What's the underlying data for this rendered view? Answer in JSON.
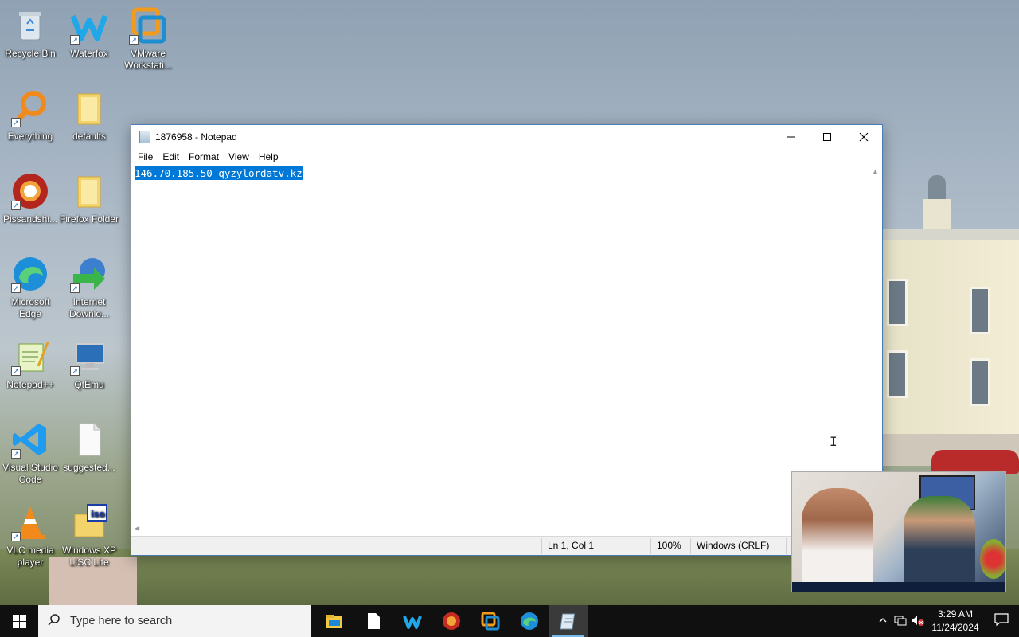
{
  "desktop": {
    "icons": [
      {
        "label": "Recycle Bin",
        "icon": "recycle-bin-icon"
      },
      {
        "label": "Waterfox",
        "icon": "waterfox-icon"
      },
      {
        "label": "VMware Workstati...",
        "icon": "vmware-icon"
      },
      {
        "label": "Everything",
        "icon": "everything-search-icon"
      },
      {
        "label": "defaults",
        "icon": "folder-icon"
      },
      {
        "label": "Pissandshi...",
        "icon": "browser-icon"
      },
      {
        "label": "Firefox Folder",
        "icon": "folder-icon"
      },
      {
        "label": "Microsoft Edge",
        "icon": "edge-icon"
      },
      {
        "label": "Internet Downlo...",
        "icon": "internet-download-manager-icon"
      },
      {
        "label": "Notepad++",
        "icon": "notepad-plus-plus-icon"
      },
      {
        "label": "QtEmu",
        "icon": "monitor-icon"
      },
      {
        "label": "Visual Studio Code",
        "icon": "vscode-icon"
      },
      {
        "label": "suggested...",
        "icon": "blank-file-icon"
      },
      {
        "label": "VLC media player",
        "icon": "vlc-cone-icon"
      },
      {
        "label": "Windows XP LISC Lite",
        "icon": "iso-folder-icon"
      }
    ]
  },
  "notepad": {
    "title": "1876958 - Notepad",
    "menu": [
      "File",
      "Edit",
      "Format",
      "View",
      "Help"
    ],
    "content": "146.70.185.50 qyzylordatv.kz",
    "status": {
      "position": "Ln 1, Col 1",
      "zoom": "100%",
      "line_ending": "Windows (CRLF)"
    }
  },
  "taskbar": {
    "search_placeholder": "Type here to search",
    "apps": [
      "file-explorer",
      "file",
      "waterfox",
      "browser",
      "vmware",
      "edge",
      "notepad"
    ],
    "clock_time": "3:29 AM",
    "clock_date": "11/24/2024"
  },
  "colors": {
    "selection": "#0078d7",
    "taskbar": "#101010"
  }
}
